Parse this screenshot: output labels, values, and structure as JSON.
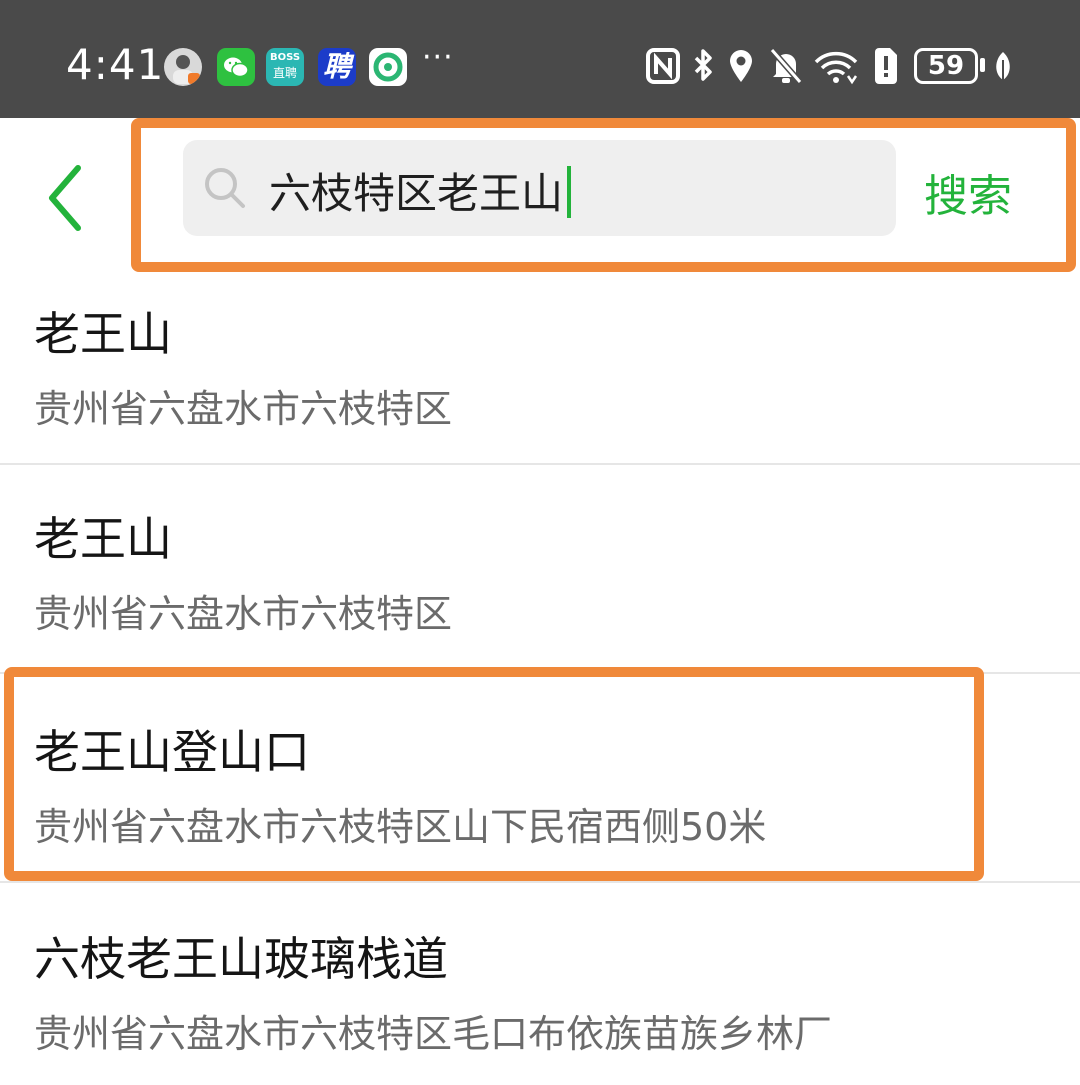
{
  "status_bar": {
    "time": "4:41",
    "app_icons": [
      {
        "name": "avatar-app-icon"
      },
      {
        "name": "wechat-icon"
      },
      {
        "name": "boss-zhipin-icon",
        "line1": "BOSS",
        "line2": "直聘"
      },
      {
        "name": "pin-app-icon",
        "label": "聘"
      },
      {
        "name": "green-app-icon"
      }
    ],
    "more": "···",
    "battery": "59"
  },
  "search": {
    "query": "六枝特区老王山",
    "button_label": "搜索"
  },
  "results": [
    {
      "title": "老王山",
      "address": "贵州省六盘水市六枝特区"
    },
    {
      "title": "老王山",
      "address": "贵州省六盘水市六枝特区"
    },
    {
      "title": "老王山登山口",
      "address": "贵州省六盘水市六枝特区山下民宿西侧50米"
    },
    {
      "title": "六枝老王山玻璃栈道",
      "address": "贵州省六盘水市六枝特区毛口布依族苗族乡林厂"
    }
  ],
  "colors": {
    "accent_green": "#23b33b",
    "highlight_orange": "#f0893a",
    "status_bar_bg": "#4a4a4a"
  }
}
